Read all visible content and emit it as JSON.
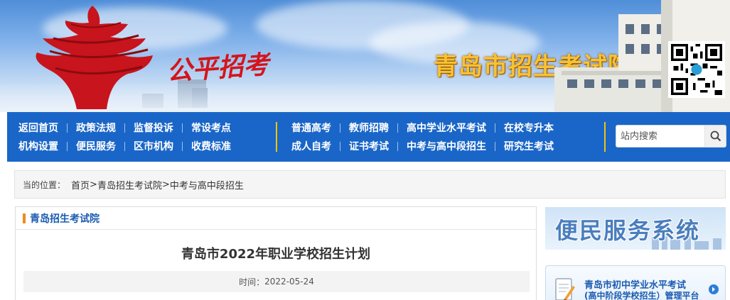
{
  "header": {
    "slogan": "公平招考",
    "site_name": "青岛市招生考试院",
    "colors": {
      "site_name": "#f7c233",
      "nav_bg": "#1a66c8",
      "accent": "#f08b1c"
    }
  },
  "nav": {
    "group1": {
      "row1": [
        "返回首页",
        "政策法规",
        "监督投诉",
        "常设考点"
      ],
      "row2": [
        "机构设置",
        "便民服务",
        "区市机构",
        "收费标准"
      ]
    },
    "group2": {
      "row1": [
        "普通高考",
        "教师招聘",
        "高中学业水平考试",
        "在校专升本"
      ],
      "row2": [
        "成人自考",
        "证书考试",
        "中考与高中段招生",
        "研究生考试"
      ]
    },
    "search": {
      "placeholder": "站内搜索",
      "icon": "search-icon"
    }
  },
  "breadcrumb": {
    "label": "当的位置：",
    "items": [
      "首页",
      "青岛招生考试院",
      "中考与高中段招生"
    ],
    "separator": ">"
  },
  "article": {
    "panel_title": "青岛招生考试院",
    "title": "青岛市2022年职业学校招生计划",
    "time_label": "时间：",
    "time": "2022-05-24"
  },
  "sidebar": {
    "service_banner": "便民服务系统",
    "portal": {
      "line1": "青岛市初中学业水平考试",
      "line2": "(高中阶段学校招生）管理平台",
      "icon": "document-pen-icon",
      "arrow_icon": "arrow-right-circle-icon"
    }
  }
}
